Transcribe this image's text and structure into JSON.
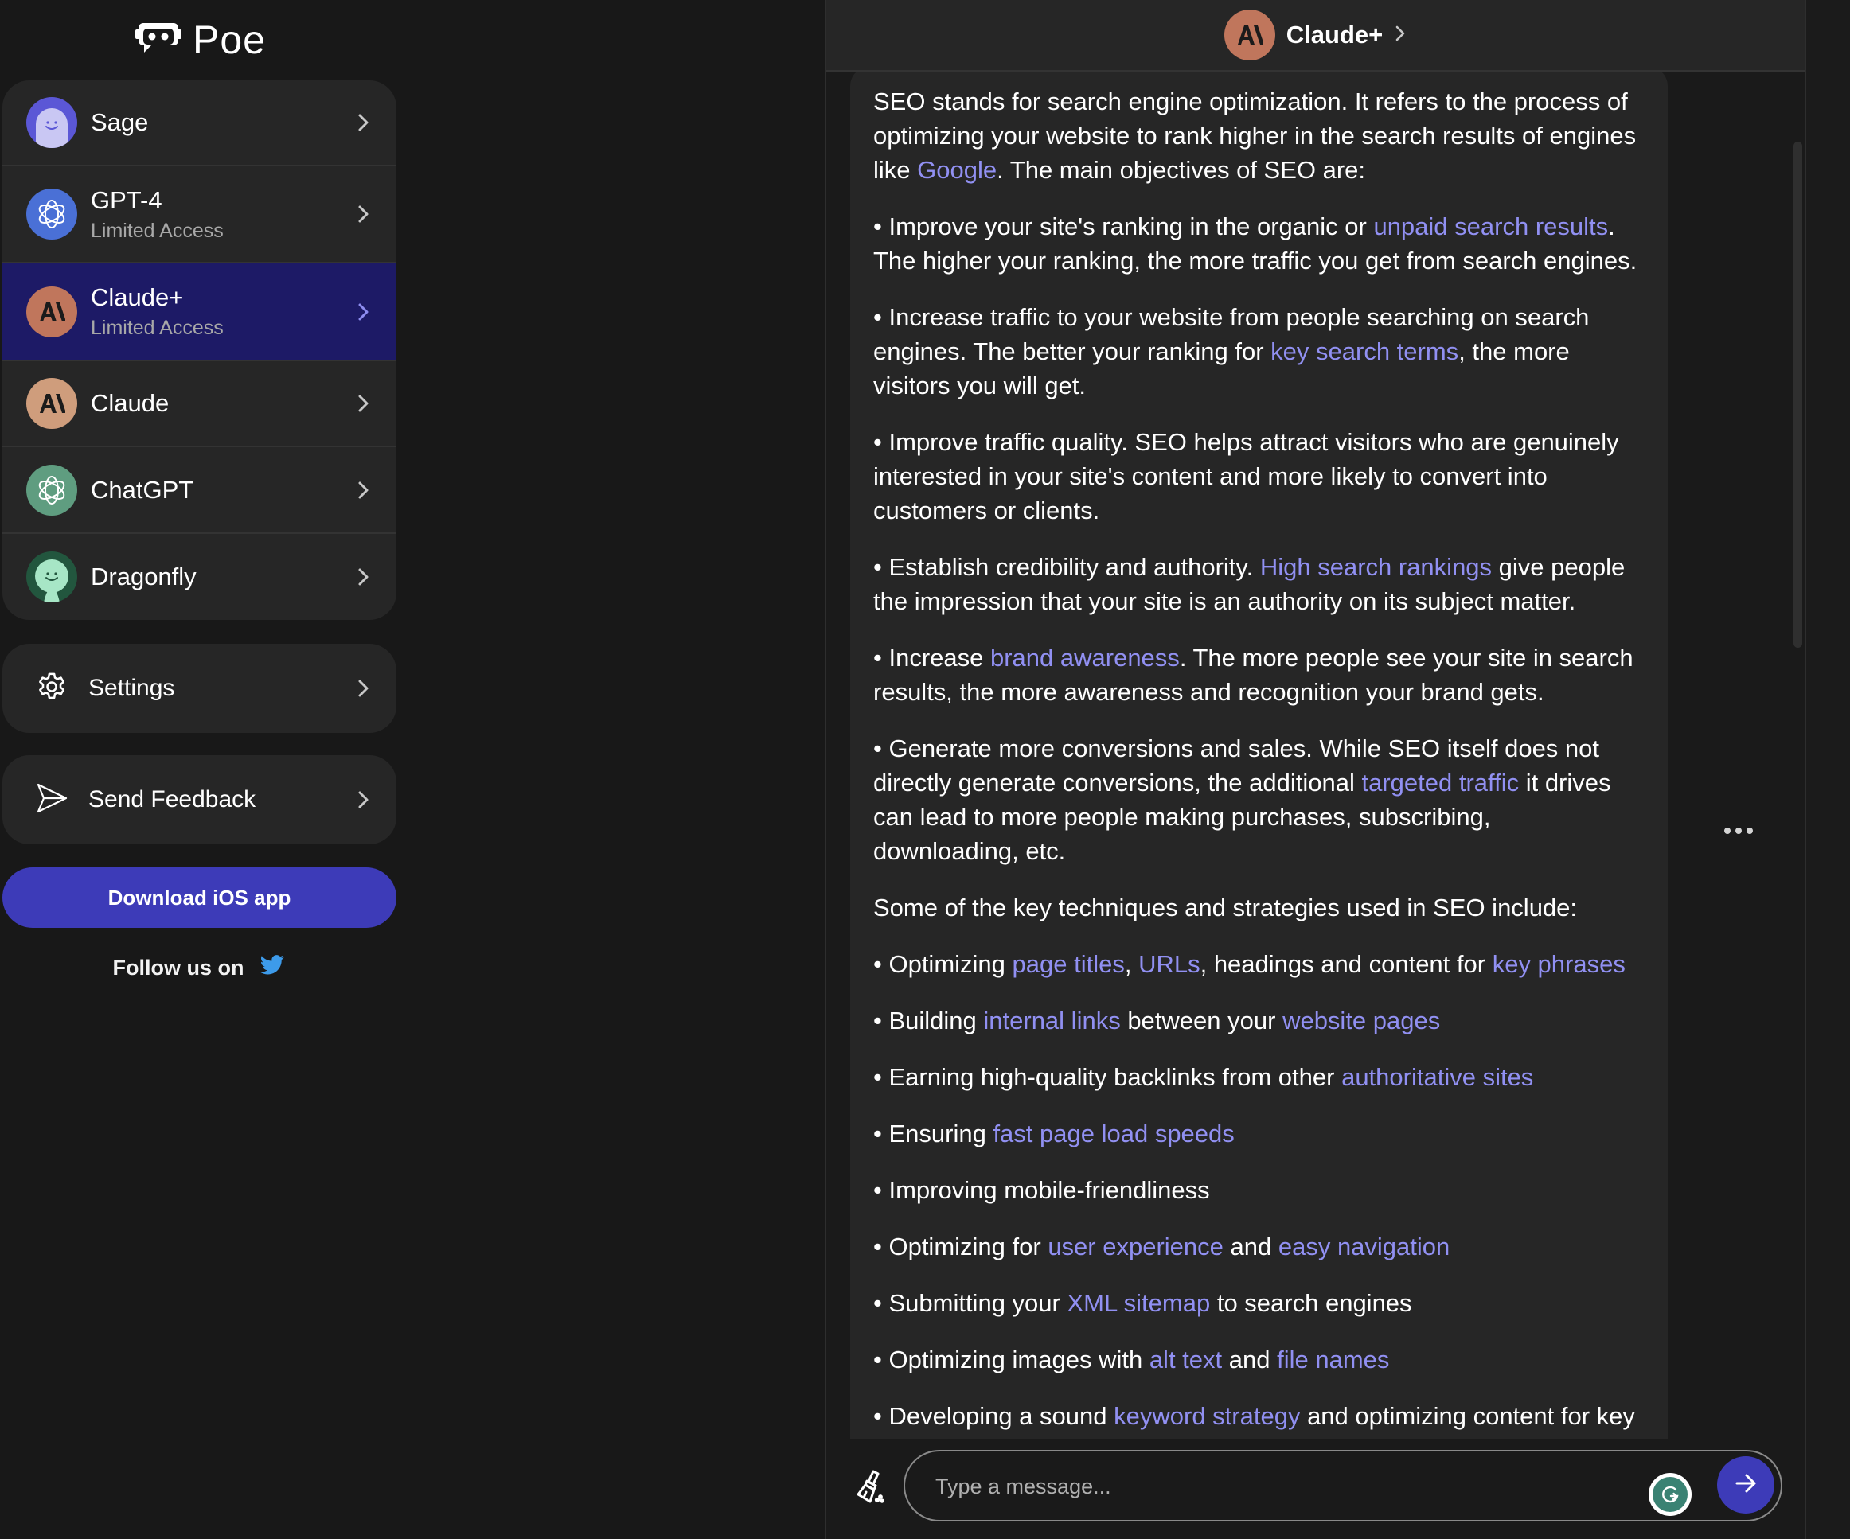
{
  "app": {
    "name": "Poe"
  },
  "colors": {
    "accent": "#3d3bb8",
    "selected_row": "#1d1a66",
    "link": "#9190f2",
    "twitter": "#3d9bea"
  },
  "sidebar": {
    "bots": [
      {
        "name": "Sage",
        "subtitle": "",
        "icon": "sage-avatar-icon",
        "selected": false
      },
      {
        "name": "GPT-4",
        "subtitle": "Limited Access",
        "icon": "openai-avatar-icon",
        "selected": false
      },
      {
        "name": "Claude+",
        "subtitle": "Limited Access",
        "icon": "anthropic-avatar-icon",
        "selected": true
      },
      {
        "name": "Claude",
        "subtitle": "",
        "icon": "anthropic-avatar-icon",
        "selected": false
      },
      {
        "name": "ChatGPT",
        "subtitle": "",
        "icon": "openai-avatar-icon",
        "selected": false
      },
      {
        "name": "Dragonfly",
        "subtitle": "",
        "icon": "dragonfly-avatar-icon",
        "selected": false
      }
    ],
    "settings_label": "Settings",
    "feedback_label": "Send Feedback",
    "download_label": "Download iOS app",
    "follow_label": "Follow us on"
  },
  "chat": {
    "bot_name": "Claude+",
    "messages": [
      {
        "sender": "Claude+",
        "paragraphs": [
          [
            {
              "t": "SEO stands for search engine optimization. It refers to the process of optimizing your website to rank higher in the search results of engines like "
            },
            {
              "t": "Google",
              "link": true
            },
            {
              "t": ". The main objectives of SEO are:"
            }
          ],
          [
            {
              "t": "• Improve your site's ranking in the organic or "
            },
            {
              "t": "unpaid search results",
              "link": true
            },
            {
              "t": ". The higher your ranking, the more traffic you get from search engines."
            }
          ],
          [
            {
              "t": "• Increase traffic to your website from people searching on search engines. The better your ranking for "
            },
            {
              "t": "key search terms",
              "link": true
            },
            {
              "t": ", the more visitors you will get."
            }
          ],
          [
            {
              "t": "• Improve traffic quality. SEO helps attract visitors who are genuinely interested in your site's content and more likely to convert into customers or clients."
            }
          ],
          [
            {
              "t": "• Establish credibility and authority. "
            },
            {
              "t": "High search rankings",
              "link": true
            },
            {
              "t": " give people the impression that your site is an authority on its subject matter."
            }
          ],
          [
            {
              "t": "• Increase "
            },
            {
              "t": "brand awareness",
              "link": true
            },
            {
              "t": ". The more people see your site in search results, the more awareness and recognition your brand gets."
            }
          ],
          [
            {
              "t": "• Generate more conversions and sales. While SEO itself does not directly generate conversions, the additional "
            },
            {
              "t": "targeted traffic",
              "link": true
            },
            {
              "t": " it drives can lead to more people making purchases, subscribing, downloading, etc."
            }
          ],
          [
            {
              "t": "Some of the key techniques and strategies used in SEO include:"
            }
          ],
          [
            {
              "t": "• Optimizing "
            },
            {
              "t": "page titles",
              "link": true
            },
            {
              "t": ", "
            },
            {
              "t": "URLs",
              "link": true
            },
            {
              "t": ", headings and content for "
            },
            {
              "t": "key phrases",
              "link": true
            }
          ],
          [
            {
              "t": "• Building "
            },
            {
              "t": "internal links",
              "link": true
            },
            {
              "t": " between your "
            },
            {
              "t": "website pages",
              "link": true
            }
          ],
          [
            {
              "t": "• Earning high-quality backlinks from other "
            },
            {
              "t": "authoritative sites",
              "link": true
            }
          ],
          [
            {
              "t": "• Ensuring "
            },
            {
              "t": "fast page load speeds",
              "link": true
            }
          ],
          [
            {
              "t": "• Improving mobile-friendliness"
            }
          ],
          [
            {
              "t": "• Optimizing for "
            },
            {
              "t": "user experience",
              "link": true
            },
            {
              "t": " and "
            },
            {
              "t": "easy navigation",
              "link": true
            }
          ],
          [
            {
              "t": "• Submitting your "
            },
            {
              "t": "XML sitemap",
              "link": true
            },
            {
              "t": " to search engines"
            }
          ],
          [
            {
              "t": "• Optimizing images with "
            },
            {
              "t": "alt text",
              "link": true
            },
            {
              "t": " and "
            },
            {
              "t": "file names",
              "link": true
            }
          ],
          [
            {
              "t": "• Developing a sound "
            },
            {
              "t": "keyword strategy",
              "link": true
            },
            {
              "t": " and optimizing content for key phrases"
            }
          ]
        ]
      }
    ],
    "input": {
      "value": "",
      "placeholder": "Type a message..."
    }
  }
}
